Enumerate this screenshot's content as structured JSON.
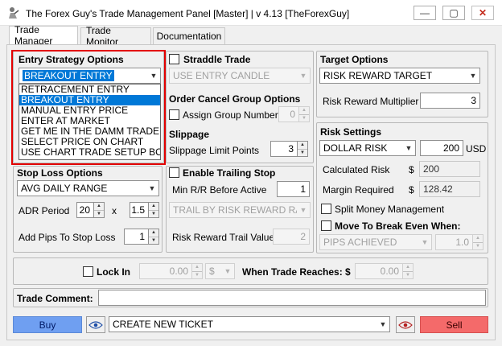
{
  "window": {
    "title": "The Forex Guy's Trade Management Panel [Master] | v 4.13 [TheForexGuy]",
    "minimize": "—",
    "maximize": "▢",
    "close": "✕"
  },
  "tabs": [
    {
      "label": "Trade Manager",
      "active": true
    },
    {
      "label": "Trade Monitor",
      "active": false
    },
    {
      "label": "Documentation",
      "active": false
    }
  ],
  "entry": {
    "header": "Entry Strategy Options",
    "selected": "BREAKOUT ENTRY",
    "options": [
      "RETRACEMENT ENTRY",
      "BREAKOUT ENTRY",
      "MANUAL ENTRY PRICE",
      "ENTER AT MARKET",
      "GET ME IN THE DAMM TRADE!",
      "SELECT PRICE ON CHART",
      "USE CHART TRADE SETUP BOX"
    ]
  },
  "straddle": {
    "label": "Straddle Trade",
    "select_value": "USE ENTRY CANDLE"
  },
  "order_cancel": {
    "header": "Order Cancel Group Options",
    "assign_label": "Assign Group Number",
    "group_number": "0"
  },
  "slippage": {
    "header": "Slippage",
    "limit_label": "Slippage Limit Points",
    "limit_value": "3"
  },
  "target": {
    "header": "Target Options",
    "select_value": "RISK REWARD TARGET",
    "multiplier_label": "Risk Reward Multiplier",
    "multiplier_value": "3"
  },
  "risk": {
    "header": "Risk Settings",
    "type": "DOLLAR RISK",
    "amount": "200",
    "currency": "USD",
    "calculated_label": "Calculated Risk",
    "calculated_symbol": "$",
    "calculated_value": "200",
    "margin_label": "Margin Required",
    "margin_symbol": "$",
    "margin_value": "128.42",
    "split_label": "Split Money Management",
    "breakeven_label": "Move To Break Even When:",
    "breakeven_select": "PIPS ACHIEVED",
    "breakeven_value": "1.0"
  },
  "stoploss": {
    "header": "Stop Loss Options",
    "select_value": "AVG DAILY RANGE",
    "adr_label": "ADR Period",
    "adr_value": "20",
    "times": "x",
    "multiplier": "1.5",
    "add_pips_label": "Add Pips To Stop Loss",
    "add_pips_value": "1"
  },
  "trailing": {
    "label": "Enable Trailing Stop",
    "min_rr_label": "Min R/R Before Active",
    "min_rr_value": "1",
    "select_value": "TRAIL BY RISK REWARD RATIO",
    "trail_value_label": "Risk Reward Trail Value",
    "trail_value": "2"
  },
  "lockin": {
    "label": "Lock In",
    "value": "0.00",
    "unit": "$",
    "when_label": "When Trade Reaches: $",
    "when_value": "0.00"
  },
  "comment": {
    "label": "Trade Comment:",
    "value": ""
  },
  "actions": {
    "buy": "Buy",
    "ticket": "CREATE NEW TICKET",
    "sell": "Sell"
  },
  "colors": {
    "highlight": "#e30000",
    "selection": "#0078d7",
    "buy": "#6f9ff1",
    "sell": "#f46a6a"
  }
}
